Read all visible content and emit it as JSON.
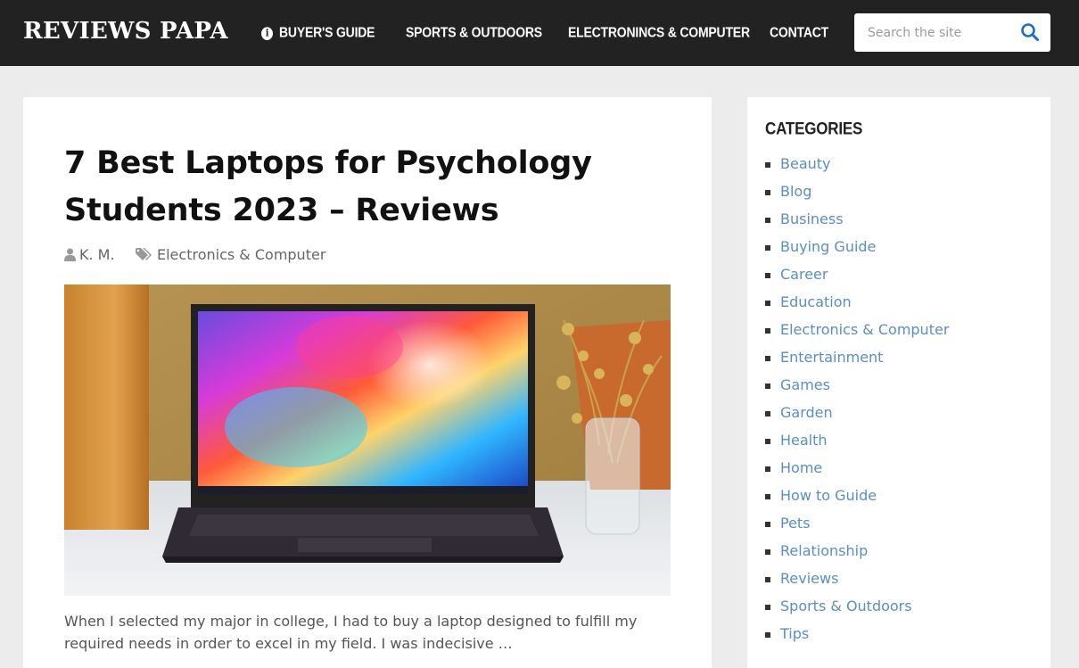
{
  "site": {
    "logo": "REVIEWS PAPA"
  },
  "nav": {
    "items": [
      {
        "label": "BUYER'S GUIDE",
        "icon": "info-icon"
      },
      {
        "label": "SPORTS & OUTDOORS"
      },
      {
        "label": "ELECTRONINCS & COMPUTER"
      },
      {
        "label": "CONTACT"
      }
    ]
  },
  "search": {
    "placeholder": "Search the site",
    "icon": "search-icon"
  },
  "post": {
    "title": "7 Best Laptops for Psychology Students 2023 – Reviews",
    "author": "K. M.",
    "category": "Electronics & Computer",
    "excerpt": "When I selected my major in college, I had to buy a laptop designed to fulfill my required needs in order to excel in my field. I was indecisive …"
  },
  "sidebar": {
    "title": "CATEGORIES",
    "categories": [
      "Beauty",
      "Blog",
      "Business",
      "Buying Guide",
      "Career",
      "Education",
      "Electronics & Computer",
      "Entertainment",
      "Games",
      "Garden",
      "Health",
      "Home",
      "How to Guide",
      "Pets",
      "Relationship",
      "Reviews",
      "Sports & Outdoors",
      "Tips"
    ]
  },
  "colors": {
    "header_bg": "#222222",
    "link": "#5a8ec4",
    "search_icon": "#1e6fc0"
  }
}
